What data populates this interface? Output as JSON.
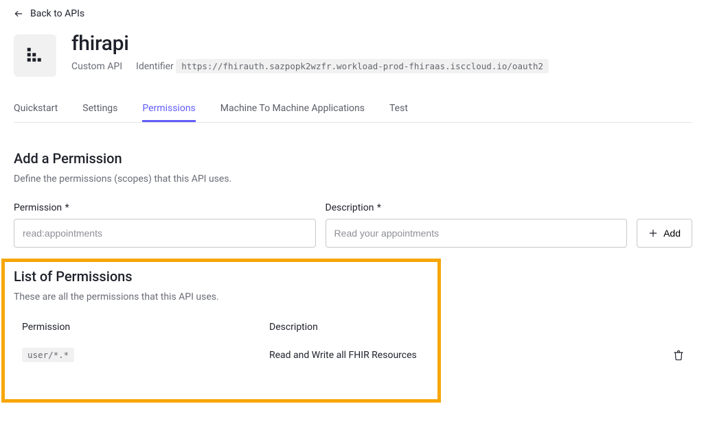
{
  "back_label": "Back to APIs",
  "api": {
    "name": "fhirapi",
    "type": "Custom API",
    "identifier_label": "Identifier",
    "identifier_value": "https://fhirauth.sazpopk2wzfr.workload-prod-fhiraas.isccloud.io/oauth2"
  },
  "tabs": {
    "quickstart": "Quickstart",
    "settings": "Settings",
    "permissions": "Permissions",
    "m2m": "Machine To Machine Applications",
    "test": "Test"
  },
  "add_section": {
    "title": "Add a Permission",
    "subtitle": "Define the permissions (scopes) that this API uses.",
    "permission_label": "Permission",
    "permission_placeholder": "read:appointments",
    "description_label": "Description",
    "description_placeholder": "Read your appointments",
    "add_button": "Add"
  },
  "list_section": {
    "title": "List of Permissions",
    "subtitle": "These are all the permissions that this API uses.",
    "col_permission": "Permission",
    "col_description": "Description",
    "rows": [
      {
        "permission": "user/*.*",
        "description": "Read and Write all FHIR Resources"
      }
    ]
  }
}
